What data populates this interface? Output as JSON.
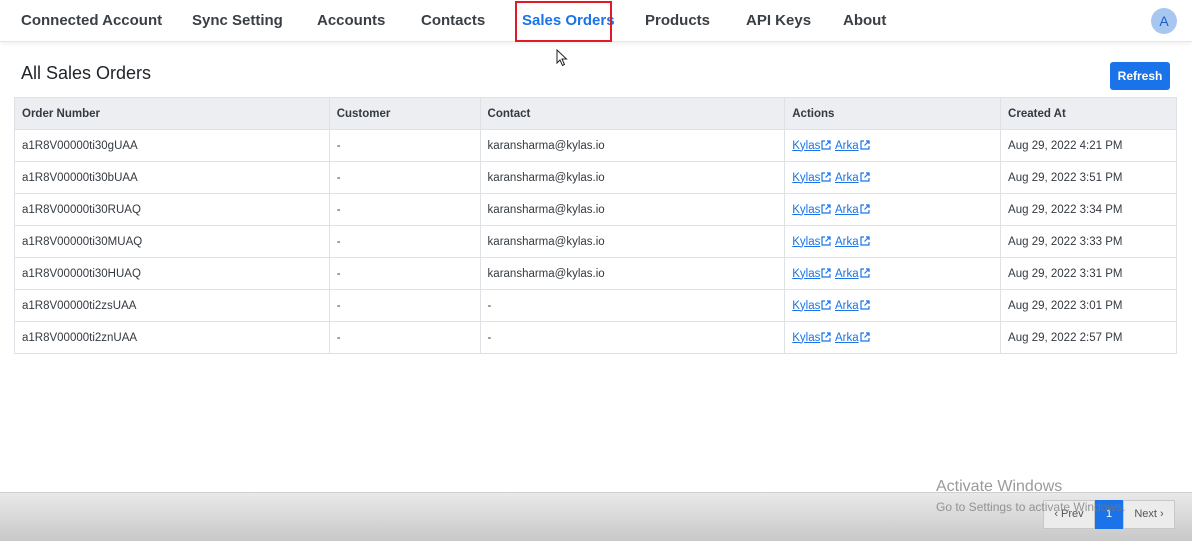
{
  "nav": {
    "items": [
      {
        "label": "Connected Account"
      },
      {
        "label": "Sync Setting"
      },
      {
        "label": "Accounts"
      },
      {
        "label": "Contacts"
      },
      {
        "label": "Sales Orders",
        "active": true
      },
      {
        "label": "Products"
      },
      {
        "label": "API Keys"
      },
      {
        "label": "About"
      }
    ],
    "avatar_initial": "A"
  },
  "page": {
    "title": "All Sales Orders",
    "refresh_label": "Refresh"
  },
  "table": {
    "headers": [
      "Order Number",
      "Customer",
      "Contact",
      "Actions",
      "Created At"
    ],
    "rows": [
      {
        "order": "a1R8V00000ti30gUAA",
        "customer": "-",
        "contact": "karansharma@kylas.io",
        "link1": "Kylas",
        "link2": "Arka",
        "created": "Aug 29, 2022 4:21 PM"
      },
      {
        "order": "a1R8V00000ti30bUAA",
        "customer": "-",
        "contact": "karansharma@kylas.io",
        "link1": "Kylas",
        "link2": "Arka",
        "created": "Aug 29, 2022 3:51 PM"
      },
      {
        "order": "a1R8V00000ti30RUAQ",
        "customer": "-",
        "contact": "karansharma@kylas.io",
        "link1": "Kylas",
        "link2": "Arka",
        "created": "Aug 29, 2022 3:34 PM"
      },
      {
        "order": "a1R8V00000ti30MUAQ",
        "customer": "-",
        "contact": "karansharma@kylas.io",
        "link1": "Kylas",
        "link2": "Arka",
        "created": "Aug 29, 2022 3:33 PM"
      },
      {
        "order": "a1R8V00000ti30HUAQ",
        "customer": "-",
        "contact": "karansharma@kylas.io",
        "link1": "Kylas",
        "link2": "Arka",
        "created": "Aug 29, 2022 3:31 PM"
      },
      {
        "order": "a1R8V00000ti2zsUAA",
        "customer": "-",
        "contact": "-",
        "link1": "Kylas",
        "link2": "Arka",
        "created": "Aug 29, 2022 3:01 PM"
      },
      {
        "order": "a1R8V00000ti2znUAA",
        "customer": "-",
        "contact": "-",
        "link1": "Kylas",
        "link2": "Arka",
        "created": "Aug 29, 2022 2:57 PM"
      }
    ]
  },
  "pagination": {
    "prev": "‹ Prev",
    "current": "1",
    "next": "Next ›"
  },
  "watermark": {
    "line1": "Activate Windows",
    "line2": "Go to Settings to activate Windows."
  },
  "colors": {
    "accent": "#1a73e8",
    "highlight_box": "#e01b24"
  },
  "icons": {
    "external_link": "external-link-icon",
    "cursor": "mouse-pointer-icon"
  }
}
